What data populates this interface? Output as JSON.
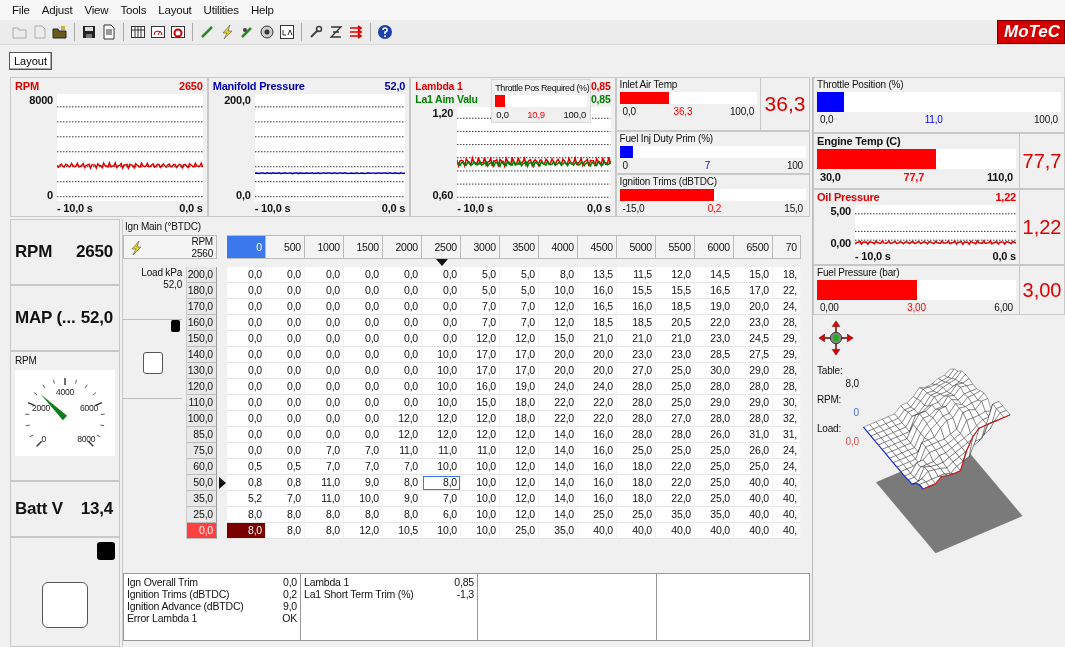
{
  "menu": [
    "File",
    "Adjust",
    "View",
    "Tools",
    "Layout",
    "Utilities",
    "Help"
  ],
  "logo": "MoTeC",
  "layout_tab": {
    "label": "Layout",
    "selected": true
  },
  "graphs": [
    {
      "traces": [
        {
          "name": "RPM",
          "value": "2650",
          "color": "#e00000"
        }
      ],
      "y_max": "8000",
      "y_min": "0",
      "t_start": "- 10,0 s",
      "t_end": "0,0 s"
    },
    {
      "traces": [
        {
          "name": "Manifold Pressure",
          "value": "52,0",
          "color": "#0000b0"
        }
      ],
      "y_max": "200,0",
      "y_min": "0,0",
      "t_start": "- 10,0 s",
      "t_end": "0,0 s"
    },
    {
      "traces": [
        {
          "name": "Lambda 1",
          "value": "0,85",
          "color": "#e00000"
        },
        {
          "name": "La1 Aim Valu",
          "value": "0,85",
          "color": "#008000"
        }
      ],
      "y_max": "1,20",
      "y_min": "0,60",
      "t_start": "- 10,0 s",
      "t_end": "0,0 s",
      "overlay": {
        "title": "Throttle Pos Required (%)",
        "color": "#ff0000",
        "level": 0.109,
        "min": "0,0",
        "reading": "10,9",
        "max": "100,0"
      }
    }
  ],
  "mini_gauges": [
    {
      "title": "Inlet Air Temp",
      "color": "#ff0000",
      "level": 0.363,
      "min": "0,0",
      "reading": "36,3",
      "max": "100,0",
      "big_value": "36,3"
    },
    {
      "title": "Fuel Inj Duty Prim (%)",
      "color": "#0000ff",
      "level": 0.07,
      "min": "0",
      "reading": "7",
      "max": "100"
    },
    {
      "title": "Ignition Trims (dBTDC)",
      "color": "#ff0000",
      "level": 0.507,
      "min": "-15,0",
      "reading": "0,2",
      "max": "15,0"
    }
  ],
  "instruments": [
    {
      "kind": "bar",
      "title": "Throttle Position (%)",
      "emphasis": false,
      "color": "#0000ff",
      "level": 0.11,
      "min": "0,0",
      "reading": "11,0",
      "max": "100,0"
    },
    {
      "kind": "bar",
      "title": "Engine Temp (C)",
      "emphasis": true,
      "color": "#ff0000",
      "level": 0.596,
      "min": "30,0",
      "reading": "77,7",
      "max": "110,0",
      "big_value": "77,7"
    },
    {
      "kind": "graph",
      "title": "Oil Pressure",
      "value": "1,22",
      "color": "#e00000",
      "y_max": "5,00",
      "y_min": "0,00",
      "t_start": "- 10,0 s",
      "t_end": "0,0 s",
      "big_value": "1,22"
    },
    {
      "kind": "bar",
      "title": "Fuel Pressure (bar)",
      "emphasis": false,
      "color": "#ff0000",
      "level": 0.5,
      "min": "0,00",
      "reading": "3,00",
      "max": "6,00",
      "big_value": "3,00"
    }
  ],
  "left_column": [
    {
      "kind": "readout",
      "label": "RPM",
      "value": "2650"
    },
    {
      "kind": "readout",
      "label": "MAP (...",
      "value": "52,0"
    },
    {
      "kind": "dial",
      "title": "RPM",
      "labels": [
        "0",
        "2000",
        "4000",
        "6000",
        "8000"
      ],
      "level": 0.331
    },
    {
      "kind": "readout",
      "label": "Batt V",
      "value": "13,4"
    }
  ],
  "ign_table": {
    "title": "Ign Main (°BTDC)",
    "x_axis_name": "RPM",
    "x_axis_value": "2560",
    "y_axis_name": "Load kPa",
    "y_axis_value": "52,0",
    "columns": [
      {
        "label": "0",
        "selected": true,
        "current": false
      },
      {
        "label": "500",
        "selected": false,
        "current": false
      },
      {
        "label": "1000",
        "selected": false,
        "current": false
      },
      {
        "label": "1500",
        "selected": false,
        "current": false
      },
      {
        "label": "2000",
        "selected": false,
        "current": false
      },
      {
        "label": "2500",
        "selected": false,
        "current": true
      },
      {
        "label": "3000",
        "selected": false,
        "current": false
      },
      {
        "label": "3500",
        "selected": false,
        "current": false
      },
      {
        "label": "4000",
        "selected": false,
        "current": false
      },
      {
        "label": "4500",
        "selected": false,
        "current": false
      },
      {
        "label": "5000",
        "selected": false,
        "current": false
      },
      {
        "label": "5500",
        "selected": false,
        "current": false
      },
      {
        "label": "6000",
        "selected": false,
        "current": false
      },
      {
        "label": "6500",
        "selected": false,
        "current": false
      },
      {
        "label": "70",
        "selected": false,
        "current": false
      }
    ],
    "rows": [
      {
        "load": "200,0",
        "selected": false,
        "current": false,
        "cells": [
          "0,0",
          "0,0",
          "0,0",
          "0,0",
          "0,0",
          "0,0",
          "5,0",
          "5,0",
          "8,0",
          "13,5",
          "11,5",
          "12,0",
          "14,5",
          "15,0",
          "18,"
        ]
      },
      {
        "load": "180,0",
        "selected": false,
        "current": false,
        "cells": [
          "0,0",
          "0,0",
          "0,0",
          "0,0",
          "0,0",
          "0,0",
          "5,0",
          "5,0",
          "10,0",
          "16,0",
          "15,5",
          "15,5",
          "16,5",
          "17,0",
          "22,"
        ]
      },
      {
        "load": "170,0",
        "selected": false,
        "current": false,
        "cells": [
          "0,0",
          "0,0",
          "0,0",
          "0,0",
          "0,0",
          "0,0",
          "7,0",
          "7,0",
          "12,0",
          "16,5",
          "16,0",
          "18,5",
          "19,0",
          "20,0",
          "24,"
        ]
      },
      {
        "load": "160,0",
        "selected": false,
        "current": false,
        "cells": [
          "0,0",
          "0,0",
          "0,0",
          "0,0",
          "0,0",
          "0,0",
          "7,0",
          "7,0",
          "12,0",
          "18,5",
          "18,5",
          "20,5",
          "22,0",
          "23,0",
          "28,"
        ]
      },
      {
        "load": "150,0",
        "selected": false,
        "current": false,
        "cells": [
          "0,0",
          "0,0",
          "0,0",
          "0,0",
          "0,0",
          "0,0",
          "12,0",
          "12,0",
          "15,0",
          "21,0",
          "21,0",
          "21,0",
          "23,0",
          "24,5",
          "29,"
        ]
      },
      {
        "load": "140,0",
        "selected": false,
        "current": false,
        "cells": [
          "0,0",
          "0,0",
          "0,0",
          "0,0",
          "0,0",
          "10,0",
          "17,0",
          "17,0",
          "20,0",
          "20,0",
          "23,0",
          "23,0",
          "28,5",
          "27,5",
          "29,"
        ]
      },
      {
        "load": "130,0",
        "selected": false,
        "current": false,
        "cells": [
          "0,0",
          "0,0",
          "0,0",
          "0,0",
          "0,0",
          "10,0",
          "17,0",
          "17,0",
          "20,0",
          "20,0",
          "27,0",
          "25,0",
          "30,0",
          "29,0",
          "28,"
        ]
      },
      {
        "load": "120,0",
        "selected": false,
        "current": false,
        "cells": [
          "0,0",
          "0,0",
          "0,0",
          "0,0",
          "0,0",
          "10,0",
          "16,0",
          "19,0",
          "24,0",
          "24,0",
          "28,0",
          "25,0",
          "28,0",
          "28,0",
          "28,"
        ]
      },
      {
        "load": "110,0",
        "selected": false,
        "current": false,
        "cells": [
          "0,0",
          "0,0",
          "0,0",
          "0,0",
          "0,0",
          "10,0",
          "15,0",
          "18,0",
          "22,0",
          "22,0",
          "28,0",
          "25,0",
          "29,0",
          "29,0",
          "30,"
        ]
      },
      {
        "load": "100,0",
        "selected": false,
        "current": false,
        "cells": [
          "0,0",
          "0,0",
          "0,0",
          "0,0",
          "12,0",
          "12,0",
          "12,0",
          "18,0",
          "22,0",
          "22,0",
          "28,0",
          "27,0",
          "28,0",
          "28,0",
          "32,"
        ]
      },
      {
        "load": "85,0",
        "selected": false,
        "current": false,
        "cells": [
          "0,0",
          "0,0",
          "0,0",
          "0,0",
          "12,0",
          "12,0",
          "12,0",
          "12,0",
          "14,0",
          "16,0",
          "28,0",
          "28,0",
          "26,0",
          "31,0",
          "31,"
        ]
      },
      {
        "load": "75,0",
        "selected": false,
        "current": false,
        "cells": [
          "0,0",
          "0,0",
          "7,0",
          "7,0",
          "11,0",
          "11,0",
          "11,0",
          "12,0",
          "14,0",
          "16,0",
          "25,0",
          "25,0",
          "25,0",
          "26,0",
          "24,"
        ]
      },
      {
        "load": "60,0",
        "selected": false,
        "current": false,
        "cells": [
          "0,5",
          "0,5",
          "7,0",
          "7,0",
          "7,0",
          "10,0",
          "10,0",
          "12,0",
          "14,0",
          "16,0",
          "18,0",
          "22,0",
          "25,0",
          "25,0",
          "24,"
        ]
      },
      {
        "load": "50,0",
        "selected": false,
        "current": true,
        "cells": [
          "0,8",
          "0,8",
          "11,0",
          "9,0",
          "8,0",
          "8,0",
          "10,0",
          "12,0",
          "14,0",
          "16,0",
          "18,0",
          "22,0",
          "25,0",
          "40,0",
          "40,"
        ]
      },
      {
        "load": "35,0",
        "selected": false,
        "current": false,
        "cells": [
          "5,2",
          "7,0",
          "11,0",
          "10,0",
          "9,0",
          "7,0",
          "10,0",
          "12,0",
          "14,0",
          "16,0",
          "18,0",
          "22,0",
          "25,0",
          "40,0",
          "40,"
        ]
      },
      {
        "load": "25,0",
        "selected": false,
        "current": false,
        "cells": [
          "8,0",
          "8,0",
          "8,0",
          "8,0",
          "8,0",
          "6,0",
          "10,0",
          "12,0",
          "14,0",
          "25,0",
          "25,0",
          "35,0",
          "35,0",
          "40,0",
          "40,"
        ]
      },
      {
        "load": "0,0",
        "selected": true,
        "current": false,
        "cells": [
          "8,0",
          "8,0",
          "8,0",
          "12,0",
          "10,5",
          "10,0",
          "10,0",
          "25,0",
          "35,0",
          "40,0",
          "40,0",
          "40,0",
          "40,0",
          "40,0",
          "40,"
        ]
      }
    ]
  },
  "info_panels": [
    {
      "items": [
        {
          "name": "Ign Overall Trim",
          "value": "0,0"
        },
        {
          "name": "Ignition Trims (dBTDC)",
          "value": "0,2"
        },
        {
          "name": "Ignition Advance (dBTDC)",
          "value": "9,0"
        },
        {
          "name": "Error Lambda 1",
          "value": "OK"
        }
      ]
    },
    {
      "items": [
        {
          "name": "Lambda 1",
          "value": "0,85"
        },
        {
          "name": "La1 Short Term Trim (%)",
          "value": "-1,3"
        }
      ]
    }
  ],
  "view3d": {
    "table_label": "Table:",
    "table_value": "8,0",
    "rpm_label": "RPM:",
    "rpm_value": "0",
    "load_label": "Load:",
    "load_value": "0,0"
  }
}
